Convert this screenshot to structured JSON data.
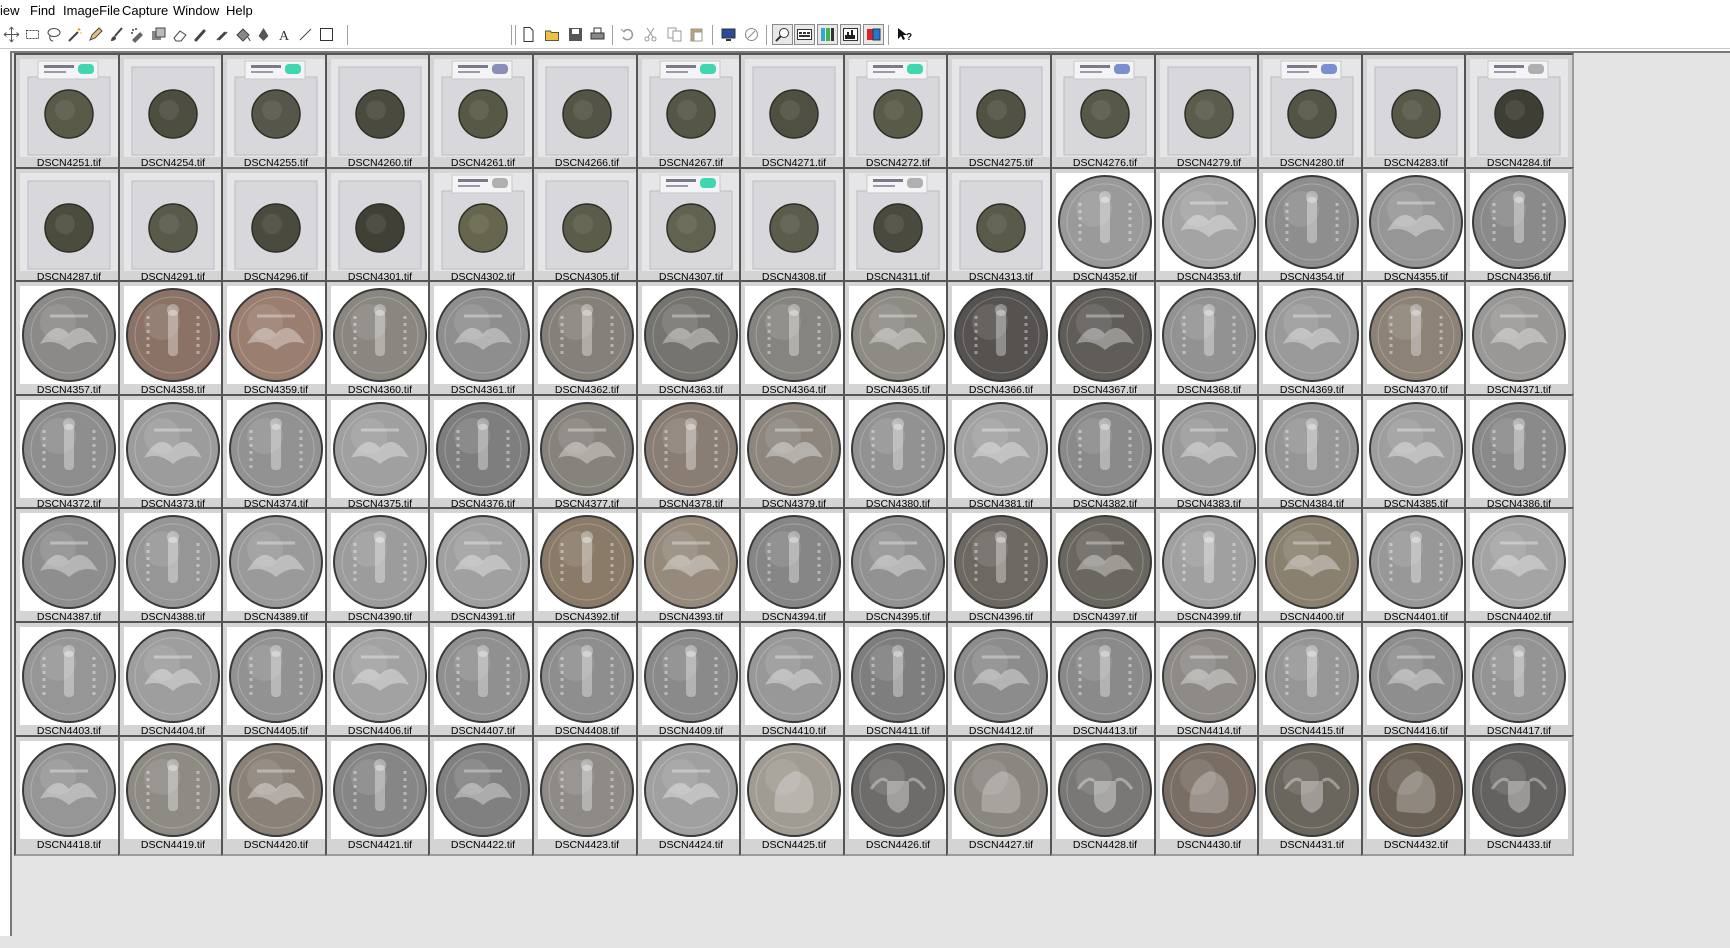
{
  "menu": [
    "iew",
    "Find",
    "ImageFile",
    "Capture",
    "Window",
    "Help"
  ],
  "toolbar": {
    "tools_left": [
      "move-icon",
      "rect-select-icon",
      "lasso-icon",
      "magic-wand-icon",
      "pencil-icon",
      "brush-icon",
      "airbrush-icon",
      "clone-icon",
      "eraser-icon",
      "smudge-icon",
      "sharpen-icon",
      "fill-bucket-icon",
      "pen-icon",
      "text-icon",
      "line-icon",
      "rectangle-icon"
    ],
    "tools_right": [
      "new-file-icon",
      "open-folder-icon",
      "save-icon",
      "print-icon",
      "undo-icon",
      "cut-icon",
      "copy-icon",
      "paste-icon",
      "capture-screen-icon",
      "capture-region-icon",
      "zoom-icon",
      "thumbnail-view-icon",
      "color-balance-icon",
      "histogram-icon",
      "channels-icon",
      "context-help-icon"
    ]
  },
  "thumbnails": [
    {
      "name": "DSCN4251.tif",
      "kind": "slab",
      "tone": "#5a5a48",
      "label_color": "#3fd6b0"
    },
    {
      "name": "DSCN4254.tif",
      "kind": "slab",
      "tone": "#4e4e40",
      "label_color": ""
    },
    {
      "name": "DSCN4255.tif",
      "kind": "slab",
      "tone": "#56564a",
      "label_color": "#3fd6b0"
    },
    {
      "name": "DSCN4260.tif",
      "kind": "slab",
      "tone": "#4a4a3e",
      "label_color": ""
    },
    {
      "name": "DSCN4261.tif",
      "kind": "slab",
      "tone": "#585846",
      "label_color": "#8a8fb8"
    },
    {
      "name": "DSCN4266.tif",
      "kind": "slab",
      "tone": "#545446",
      "label_color": ""
    },
    {
      "name": "DSCN4267.tif",
      "kind": "slab",
      "tone": "#565646",
      "label_color": "#3fd6b0"
    },
    {
      "name": "DSCN4271.tif",
      "kind": "slab",
      "tone": "#505042",
      "label_color": ""
    },
    {
      "name": "DSCN4272.tif",
      "kind": "slab",
      "tone": "#5a5a48",
      "label_color": "#3fd6b0"
    },
    {
      "name": "DSCN4275.tif",
      "kind": "slab",
      "tone": "#525244",
      "label_color": ""
    },
    {
      "name": "DSCN4276.tif",
      "kind": "slab",
      "tone": "#585848",
      "label_color": "#7b8fd0"
    },
    {
      "name": "DSCN4279.tif",
      "kind": "slab",
      "tone": "#5c5c4c",
      "label_color": ""
    },
    {
      "name": "DSCN4280.tif",
      "kind": "slab",
      "tone": "#545446",
      "label_color": "#7b8fd0"
    },
    {
      "name": "DSCN4283.tif",
      "kind": "slab",
      "tone": "#585848",
      "label_color": ""
    },
    {
      "name": "DSCN4284.tif",
      "kind": "slab",
      "tone": "#3e3e34",
      "label_color": "#b0b0b0"
    },
    {
      "name": "DSCN4287.tif",
      "kind": "slab",
      "tone": "#4c4c3e",
      "label_color": ""
    },
    {
      "name": "DSCN4291.tif",
      "kind": "slab",
      "tone": "#5a5a4a",
      "label_color": ""
    },
    {
      "name": "DSCN4296.tif",
      "kind": "slab",
      "tone": "#4a4a3e",
      "label_color": ""
    },
    {
      "name": "DSCN4301.tif",
      "kind": "slab",
      "tone": "#404036",
      "label_color": ""
    },
    {
      "name": "DSCN4302.tif",
      "kind": "slab",
      "tone": "#66664e",
      "label_color": "#b0b0b0"
    },
    {
      "name": "DSCN4305.tif",
      "kind": "slab",
      "tone": "#5c5c4a",
      "label_color": ""
    },
    {
      "name": "DSCN4307.tif",
      "kind": "slab",
      "tone": "#626250",
      "label_color": "#3fd6b0"
    },
    {
      "name": "DSCN4308.tif",
      "kind": "slab",
      "tone": "#5c5c4c",
      "label_color": ""
    },
    {
      "name": "DSCN4311.tif",
      "kind": "slab",
      "tone": "#4a4a3e",
      "label_color": "#b0b0b0"
    },
    {
      "name": "DSCN4313.tif",
      "kind": "slab",
      "tone": "#5a5a4a",
      "label_color": ""
    },
    {
      "name": "DSCN4352.tif",
      "kind": "obverse",
      "tone": "#9a9a9a",
      "label_color": ""
    },
    {
      "name": "DSCN4353.tif",
      "kind": "reverse",
      "tone": "#a4a4a4",
      "label_color": ""
    },
    {
      "name": "DSCN4354.tif",
      "kind": "obverse",
      "tone": "#8e8e8e",
      "label_color": ""
    },
    {
      "name": "DSCN4355.tif",
      "kind": "reverse",
      "tone": "#969696",
      "label_color": ""
    },
    {
      "name": "DSCN4356.tif",
      "kind": "obverse",
      "tone": "#8a8a8a",
      "label_color": ""
    },
    {
      "name": "DSCN4357.tif",
      "kind": "reverse",
      "tone": "#8c8a88",
      "label_color": ""
    },
    {
      "name": "DSCN4358.tif",
      "kind": "obverse",
      "tone": "#8a7266",
      "label_color": ""
    },
    {
      "name": "DSCN4359.tif",
      "kind": "reverse",
      "tone": "#9a7e70",
      "label_color": ""
    },
    {
      "name": "DSCN4360.tif",
      "kind": "obverse",
      "tone": "#8a8680",
      "label_color": ""
    },
    {
      "name": "DSCN4361.tif",
      "kind": "reverse",
      "tone": "#8e8e8e",
      "label_color": ""
    },
    {
      "name": "DSCN4362.tif",
      "kind": "obverse",
      "tone": "#86807a",
      "label_color": ""
    },
    {
      "name": "DSCN4363.tif",
      "kind": "reverse",
      "tone": "#76746f",
      "label_color": ""
    },
    {
      "name": "DSCN4364.tif",
      "kind": "obverse",
      "tone": "#86847e",
      "label_color": ""
    },
    {
      "name": "DSCN4365.tif",
      "kind": "reverse",
      "tone": "#8e8a84",
      "label_color": ""
    },
    {
      "name": "DSCN4366.tif",
      "kind": "obverse",
      "tone": "#555250",
      "label_color": ""
    },
    {
      "name": "DSCN4367.tif",
      "kind": "reverse",
      "tone": "#605c58",
      "label_color": ""
    },
    {
      "name": "DSCN4368.tif",
      "kind": "obverse",
      "tone": "#929292",
      "label_color": ""
    },
    {
      "name": "DSCN4369.tif",
      "kind": "reverse",
      "tone": "#9a9a9a",
      "label_color": ""
    },
    {
      "name": "DSCN4370.tif",
      "kind": "obverse",
      "tone": "#8c8276",
      "label_color": ""
    },
    {
      "name": "DSCN4371.tif",
      "kind": "reverse",
      "tone": "#9a9896",
      "label_color": ""
    },
    {
      "name": "DSCN4372.tif",
      "kind": "obverse",
      "tone": "#8e8e8e",
      "label_color": ""
    },
    {
      "name": "DSCN4373.tif",
      "kind": "reverse",
      "tone": "#9c9c9c",
      "label_color": ""
    },
    {
      "name": "DSCN4374.tif",
      "kind": "obverse",
      "tone": "#929292",
      "label_color": ""
    },
    {
      "name": "DSCN4375.tif",
      "kind": "reverse",
      "tone": "#a0a0a0",
      "label_color": ""
    },
    {
      "name": "DSCN4376.tif",
      "kind": "obverse",
      "tone": "#7e7e7e",
      "label_color": ""
    },
    {
      "name": "DSCN4377.tif",
      "kind": "reverse",
      "tone": "#86827c",
      "label_color": ""
    },
    {
      "name": "DSCN4378.tif",
      "kind": "obverse",
      "tone": "#8a7e74",
      "label_color": ""
    },
    {
      "name": "DSCN4379.tif",
      "kind": "reverse",
      "tone": "#8c867e",
      "label_color": ""
    },
    {
      "name": "DSCN4380.tif",
      "kind": "obverse",
      "tone": "#929292",
      "label_color": ""
    },
    {
      "name": "DSCN4381.tif",
      "kind": "reverse",
      "tone": "#a2a2a2",
      "label_color": ""
    },
    {
      "name": "DSCN4382.tif",
      "kind": "obverse",
      "tone": "#8a8a8a",
      "label_color": ""
    },
    {
      "name": "DSCN4383.tif",
      "kind": "reverse",
      "tone": "#9a9a9a",
      "label_color": ""
    },
    {
      "name": "DSCN4384.tif",
      "kind": "obverse",
      "tone": "#969696",
      "label_color": ""
    },
    {
      "name": "DSCN4385.tif",
      "kind": "reverse",
      "tone": "#9e9e9e",
      "label_color": ""
    },
    {
      "name": "DSCN4386.tif",
      "kind": "obverse",
      "tone": "#8a8a8a",
      "label_color": ""
    },
    {
      "name": "DSCN4387.tif",
      "kind": "reverse",
      "tone": "#8e8e8e",
      "label_color": ""
    },
    {
      "name": "DSCN4388.tif",
      "kind": "obverse",
      "tone": "#969696",
      "label_color": ""
    },
    {
      "name": "DSCN4389.tif",
      "kind": "reverse",
      "tone": "#9a9a9a",
      "label_color": ""
    },
    {
      "name": "DSCN4390.tif",
      "kind": "obverse",
      "tone": "#9c9c9c",
      "label_color": ""
    },
    {
      "name": "DSCN4391.tif",
      "kind": "reverse",
      "tone": "#a0a0a0",
      "label_color": ""
    },
    {
      "name": "DSCN4392.tif",
      "kind": "obverse",
      "tone": "#8a7a68",
      "label_color": ""
    },
    {
      "name": "DSCN4393.tif",
      "kind": "reverse",
      "tone": "#968a7c",
      "label_color": ""
    },
    {
      "name": "DSCN4394.tif",
      "kind": "obverse",
      "tone": "#868686",
      "label_color": ""
    },
    {
      "name": "DSCN4395.tif",
      "kind": "reverse",
      "tone": "#929292",
      "label_color": ""
    },
    {
      "name": "DSCN4396.tif",
      "kind": "obverse",
      "tone": "#6e6862",
      "label_color": ""
    },
    {
      "name": "DSCN4397.tif",
      "kind": "reverse",
      "tone": "#6a6660",
      "label_color": ""
    },
    {
      "name": "DSCN4399.tif",
      "kind": "obverse",
      "tone": "#a0a0a0",
      "label_color": ""
    },
    {
      "name": "DSCN4400.tif",
      "kind": "reverse",
      "tone": "#8a8070",
      "label_color": ""
    },
    {
      "name": "DSCN4401.tif",
      "kind": "obverse",
      "tone": "#989898",
      "label_color": ""
    },
    {
      "name": "DSCN4402.tif",
      "kind": "reverse",
      "tone": "#a4a4a4",
      "label_color": ""
    },
    {
      "name": "DSCN4403.tif",
      "kind": "obverse",
      "tone": "#969696",
      "label_color": ""
    },
    {
      "name": "DSCN4404.tif",
      "kind": "reverse",
      "tone": "#9e9e9e",
      "label_color": ""
    },
    {
      "name": "DSCN4405.tif",
      "kind": "obverse",
      "tone": "#929292",
      "label_color": ""
    },
    {
      "name": "DSCN4406.tif",
      "kind": "reverse",
      "tone": "#a2a2a2",
      "label_color": ""
    },
    {
      "name": "DSCN4407.tif",
      "kind": "obverse",
      "tone": "#909090",
      "label_color": ""
    },
    {
      "name": "DSCN4408.tif",
      "kind": "obverse",
      "tone": "#8e8e8e",
      "label_color": ""
    },
    {
      "name": "DSCN4409.tif",
      "kind": "obverse",
      "tone": "#8a8a8a",
      "label_color": ""
    },
    {
      "name": "DSCN4410.tif",
      "kind": "reverse",
      "tone": "#989898",
      "label_color": ""
    },
    {
      "name": "DSCN4411.tif",
      "kind": "obverse",
      "tone": "#7e7e7e",
      "label_color": ""
    },
    {
      "name": "DSCN4412.tif",
      "kind": "reverse",
      "tone": "#8c8c8c",
      "label_color": ""
    },
    {
      "name": "DSCN4413.tif",
      "kind": "obverse",
      "tone": "#8a8a8a",
      "label_color": ""
    },
    {
      "name": "DSCN4414.tif",
      "kind": "reverse",
      "tone": "#8e8a86",
      "label_color": ""
    },
    {
      "name": "DSCN4415.tif",
      "kind": "obverse",
      "tone": "#969696",
      "label_color": ""
    },
    {
      "name": "DSCN4416.tif",
      "kind": "reverse",
      "tone": "#8e8e8e",
      "label_color": ""
    },
    {
      "name": "DSCN4417.tif",
      "kind": "obverse",
      "tone": "#949494",
      "label_color": ""
    },
    {
      "name": "DSCN4418.tif",
      "kind": "reverse",
      "tone": "#969696",
      "label_color": ""
    },
    {
      "name": "DSCN4419.tif",
      "kind": "obverse",
      "tone": "#8e8a84",
      "label_color": ""
    },
    {
      "name": "DSCN4420.tif",
      "kind": "reverse",
      "tone": "#8a8278",
      "label_color": ""
    },
    {
      "name": "DSCN4421.tif",
      "kind": "obverse",
      "tone": "#868686",
      "label_color": ""
    },
    {
      "name": "DSCN4422.tif",
      "kind": "reverse",
      "tone": "#808080",
      "label_color": ""
    },
    {
      "name": "DSCN4423.tif",
      "kind": "obverse",
      "tone": "#8e8a86",
      "label_color": ""
    },
    {
      "name": "DSCN4424.tif",
      "kind": "reverse",
      "tone": "#a0a0a0",
      "label_color": ""
    },
    {
      "name": "DSCN4425.tif",
      "kind": "barber",
      "tone": "#a09c94",
      "label_color": ""
    },
    {
      "name": "DSCN4426.tif",
      "kind": "shield",
      "tone": "#6e6c6a",
      "label_color": ""
    },
    {
      "name": "DSCN4427.tif",
      "kind": "barber",
      "tone": "#8a8680",
      "label_color": ""
    },
    {
      "name": "DSCN4428.tif",
      "kind": "shield",
      "tone": "#7a7876",
      "label_color": ""
    },
    {
      "name": "DSCN4430.tif",
      "kind": "barber",
      "tone": "#7a6e64",
      "label_color": ""
    },
    {
      "name": "DSCN4431.tif",
      "kind": "shield",
      "tone": "#6a665e",
      "label_color": ""
    },
    {
      "name": "DSCN4432.tif",
      "kind": "barber",
      "tone": "#6a6054",
      "label_color": ""
    },
    {
      "name": "DSCN4433.tif",
      "kind": "shield",
      "tone": "#646260",
      "label_color": ""
    }
  ]
}
